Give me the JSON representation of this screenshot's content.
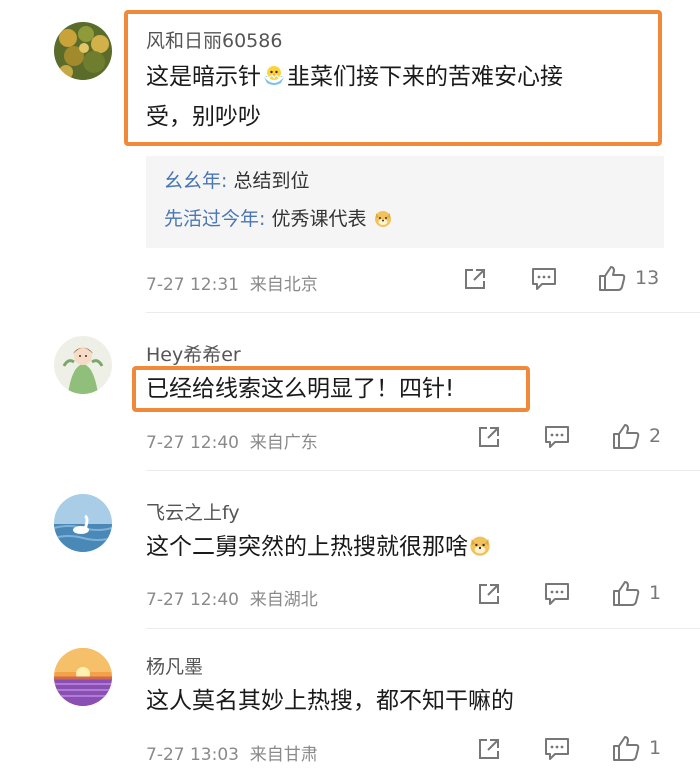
{
  "comments": [
    {
      "username": "风和日丽60586",
      "text_line1_a": "这是暗示针",
      "text_line1_b": "韭菜们接下来的苦难安心接",
      "text_line2": "受，别吵吵",
      "inline_icon": "chick-emoji",
      "replies": [
        {
          "name": "幺幺年",
          "sep": ":",
          "text": " 总结到位"
        },
        {
          "name": "先活过今年",
          "sep": ":",
          "text": " 优秀课代表",
          "emoji": "doge-emoji"
        }
      ],
      "date": "7-27 12:31",
      "location": "来自北京",
      "likes": "13",
      "highlighted": true
    },
    {
      "username": "Hey希希er",
      "text": "已经给线索这么明显了！四针!",
      "date": "7-27 12:40",
      "location": "来自广东",
      "likes": "2",
      "highlighted": true
    },
    {
      "username": "飞云之上fy",
      "text": "这个二舅突然的上热搜就很那啥",
      "emoji": "doge-emoji",
      "date": "7-27 12:40",
      "location": "来自湖北",
      "likes": "1"
    },
    {
      "username": "杨凡墨",
      "text": "这人莫名其妙上热搜，都不知干嘛的",
      "date": "7-27 13:03",
      "location": "来自甘肃",
      "likes": "1"
    }
  ],
  "icons": {
    "share": "share-icon",
    "comment": "comment-icon",
    "like": "thumbs-up-icon"
  },
  "colors": {
    "highlight": "#f08a3a",
    "reply_name": "#4a77b4",
    "meta": "#8a8a8a"
  }
}
